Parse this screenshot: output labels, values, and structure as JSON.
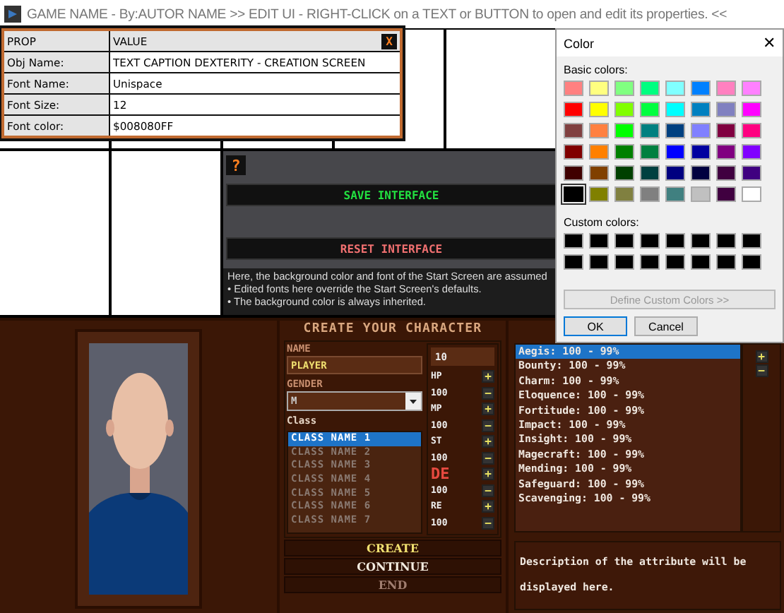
{
  "window": {
    "title": "GAME NAME - By:AUTOR NAME >> EDIT UI - RIGHT-CLICK on a TEXT or BUTTON to open and edit its properties. <<"
  },
  "property_table": {
    "header": [
      "PROP",
      "VALUE"
    ],
    "close": "X",
    "rows": [
      {
        "prop": "Obj Name:",
        "value": "TEXT CAPTION DEXTERITY - CREATION SCREEN"
      },
      {
        "prop": "Font Name:",
        "value": "Unispace"
      },
      {
        "prop": "Font Size:",
        "value": "12"
      },
      {
        "prop": "Font color:",
        "value": "$008080FF"
      }
    ]
  },
  "editor_panel": {
    "help_button": "?",
    "save": "SAVE INTERFACE",
    "reset": "RESET INTERFACE",
    "notes": [
      "Here, the background color and font of the Start Screen are assumed",
      "• Edited fonts here override the Start Screen's defaults.",
      "• The background color is always inherited."
    ]
  },
  "color_dialog": {
    "title": "Color",
    "close": "✕",
    "basic_label": "Basic colors:",
    "custom_label": "Custom colors:",
    "basic_colors": [
      {
        "color": "#ff8080",
        "selected": false
      },
      {
        "color": "#ffff80",
        "selected": false
      },
      {
        "color": "#80ff80",
        "selected": false
      },
      {
        "color": "#00ff80",
        "selected": false
      },
      {
        "color": "#80ffff",
        "selected": false
      },
      {
        "color": "#0080ff",
        "selected": false
      },
      {
        "color": "#ff80c0",
        "selected": false
      },
      {
        "color": "#ff80ff",
        "selected": false
      },
      {
        "color": "#ff0000",
        "selected": false
      },
      {
        "color": "#ffff00",
        "selected": false
      },
      {
        "color": "#80ff00",
        "selected": false
      },
      {
        "color": "#00ff40",
        "selected": false
      },
      {
        "color": "#00ffff",
        "selected": false
      },
      {
        "color": "#0080c0",
        "selected": false
      },
      {
        "color": "#8080c0",
        "selected": false
      },
      {
        "color": "#ff00ff",
        "selected": false
      },
      {
        "color": "#804040",
        "selected": false
      },
      {
        "color": "#ff8040",
        "selected": false
      },
      {
        "color": "#00ff00",
        "selected": false
      },
      {
        "color": "#008080",
        "selected": false
      },
      {
        "color": "#004080",
        "selected": false
      },
      {
        "color": "#8080ff",
        "selected": false
      },
      {
        "color": "#800040",
        "selected": false
      },
      {
        "color": "#ff0080",
        "selected": false
      },
      {
        "color": "#800000",
        "selected": false
      },
      {
        "color": "#ff8000",
        "selected": false
      },
      {
        "color": "#008000",
        "selected": false
      },
      {
        "color": "#008040",
        "selected": false
      },
      {
        "color": "#0000ff",
        "selected": false
      },
      {
        "color": "#0000a0",
        "selected": false
      },
      {
        "color": "#800080",
        "selected": false
      },
      {
        "color": "#8000ff",
        "selected": false
      },
      {
        "color": "#400000",
        "selected": false
      },
      {
        "color": "#804000",
        "selected": false
      },
      {
        "color": "#004000",
        "selected": false
      },
      {
        "color": "#004040",
        "selected": false
      },
      {
        "color": "#000080",
        "selected": false
      },
      {
        "color": "#000040",
        "selected": false
      },
      {
        "color": "#400040",
        "selected": false
      },
      {
        "color": "#400080",
        "selected": false
      },
      {
        "color": "#000000",
        "selected": true
      },
      {
        "color": "#808000",
        "selected": false
      },
      {
        "color": "#808040",
        "selected": false
      },
      {
        "color": "#808080",
        "selected": false
      },
      {
        "color": "#408080",
        "selected": false
      },
      {
        "color": "#c0c0c0",
        "selected": false
      },
      {
        "color": "#400040",
        "selected": false
      },
      {
        "color": "#ffffff",
        "selected": false
      }
    ],
    "custom_colors": [
      {
        "color": "#000000",
        "selected": false
      },
      {
        "color": "#000000",
        "selected": false
      },
      {
        "color": "#000000",
        "selected": false
      },
      {
        "color": "#000000",
        "selected": false
      },
      {
        "color": "#000000",
        "selected": false
      },
      {
        "color": "#000000",
        "selected": false
      },
      {
        "color": "#000000",
        "selected": false
      },
      {
        "color": "#000000",
        "selected": false
      },
      {
        "color": "#000000",
        "selected": false
      },
      {
        "color": "#000000",
        "selected": false
      },
      {
        "color": "#000000",
        "selected": false
      },
      {
        "color": "#000000",
        "selected": false
      },
      {
        "color": "#000000",
        "selected": false
      },
      {
        "color": "#000000",
        "selected": false
      },
      {
        "color": "#000000",
        "selected": false
      },
      {
        "color": "#000000",
        "selected": false
      }
    ],
    "define_button": {
      "label": "Define Custom Colors >>",
      "disabled": true
    },
    "ok": "OK",
    "cancel": "Cancel"
  },
  "character": {
    "title": "CREATE YOUR CHARACTER",
    "name_label": "NAME",
    "name_value": "PLAYER",
    "gender_label": "GENDER",
    "gender_value": "M",
    "class_label": "Class",
    "classes": [
      {
        "label": "CLASS NAME 1",
        "selected": true
      },
      {
        "label": "CLASS NAME 2",
        "selected": false
      },
      {
        "label": "CLASS NAME 3",
        "selected": false
      },
      {
        "label": "CLASS NAME 4",
        "selected": false
      },
      {
        "label": "CLASS NAME 5",
        "selected": false
      },
      {
        "label": "CLASS NAME 6",
        "selected": false
      },
      {
        "label": "CLASS NAME 7",
        "selected": false
      }
    ],
    "points": "10",
    "stats": [
      {
        "label": "HP",
        "value": "100",
        "highlighted": false
      },
      {
        "label": "MP",
        "value": "100",
        "highlighted": false
      },
      {
        "label": "ST",
        "value": "100",
        "highlighted": false
      },
      {
        "label": "DE",
        "value": "100",
        "highlighted": true
      },
      {
        "label": "RE",
        "value": "100",
        "highlighted": false
      }
    ],
    "plus": "+",
    "minus": "−",
    "buttons": [
      {
        "label": "CREATE",
        "color": "#f0e070"
      },
      {
        "label": "CONTINUE",
        "color": "#f4ece0"
      },
      {
        "label": "END",
        "color": "#a07e70"
      }
    ]
  },
  "attributes": [
    {
      "label": "Aegis: 100 - 99%",
      "selected": true
    },
    {
      "label": "Bounty: 100 - 99%",
      "selected": false
    },
    {
      "label": "Charm: 100 - 99%",
      "selected": false
    },
    {
      "label": "Eloquence: 100 - 99%",
      "selected": false
    },
    {
      "label": "Fortitude: 100 - 99%",
      "selected": false
    },
    {
      "label": "Impact: 100 - 99%",
      "selected": false
    },
    {
      "label": "Insight: 100 - 99%",
      "selected": false
    },
    {
      "label": "Magecraft: 100 - 99%",
      "selected": false
    },
    {
      "label": "Mending: 100 - 99%",
      "selected": false
    },
    {
      "label": "Safeguard: 100 - 99%",
      "selected": false
    },
    {
      "label": "Scavenging: 100 - 99%",
      "selected": false
    }
  ],
  "description": "Description of the attribute will be displayed here."
}
